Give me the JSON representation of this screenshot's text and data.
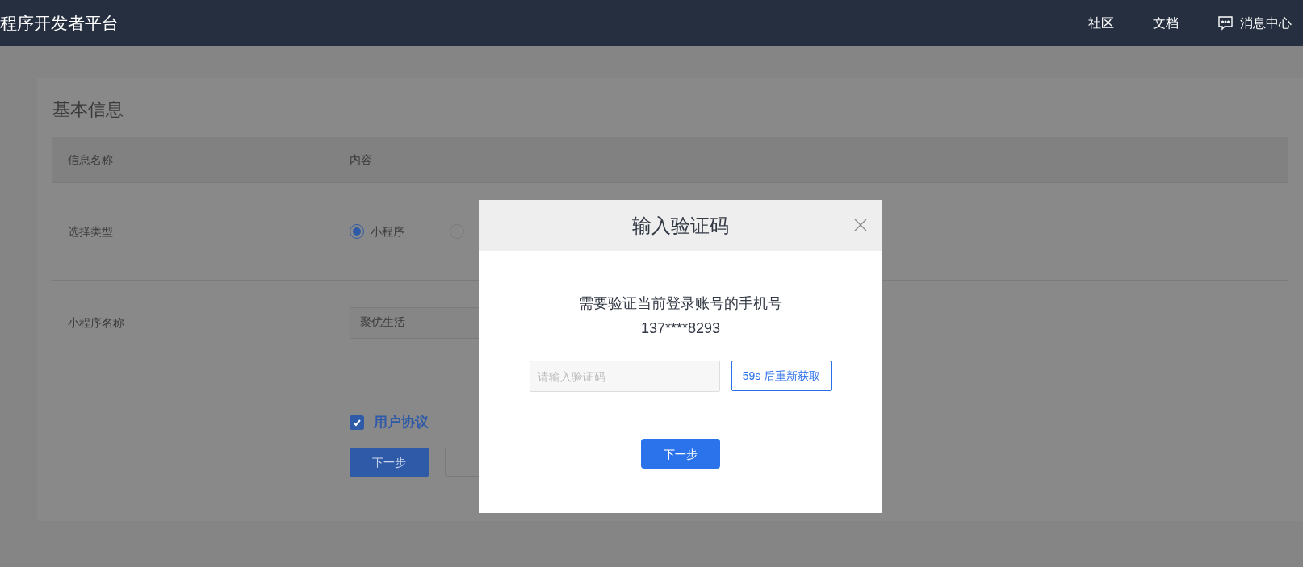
{
  "header": {
    "title": "程序开发者平台",
    "nav": [
      {
        "label": "社区",
        "kind": "link"
      },
      {
        "label": "文档",
        "kind": "link"
      },
      {
        "label": "消息中心",
        "kind": "messages"
      }
    ]
  },
  "card": {
    "title": "基本信息",
    "columns": [
      "信息名称",
      "内容"
    ],
    "rows": [
      {
        "kind": "radio",
        "label": "选择类型",
        "options": [
          {
            "label": "小程序",
            "selected": true
          },
          {
            "selected": false
          }
        ]
      },
      {
        "kind": "input",
        "label": "小程序名称",
        "value": "聚优生活"
      }
    ],
    "agreement": {
      "label": "用户协议",
      "checked": true
    },
    "buttons": [
      {
        "label": "下一步",
        "kind": "primary"
      },
      {
        "kind": "default"
      }
    ]
  },
  "dialog": {
    "title": "输入验证码",
    "message": "需要验证当前登录账号的手机号",
    "phone": "137****8293",
    "code_field": {
      "placeholder": "请输入验证码"
    },
    "resend_button": "59s 后重新获取",
    "next_button": "下一步"
  }
}
